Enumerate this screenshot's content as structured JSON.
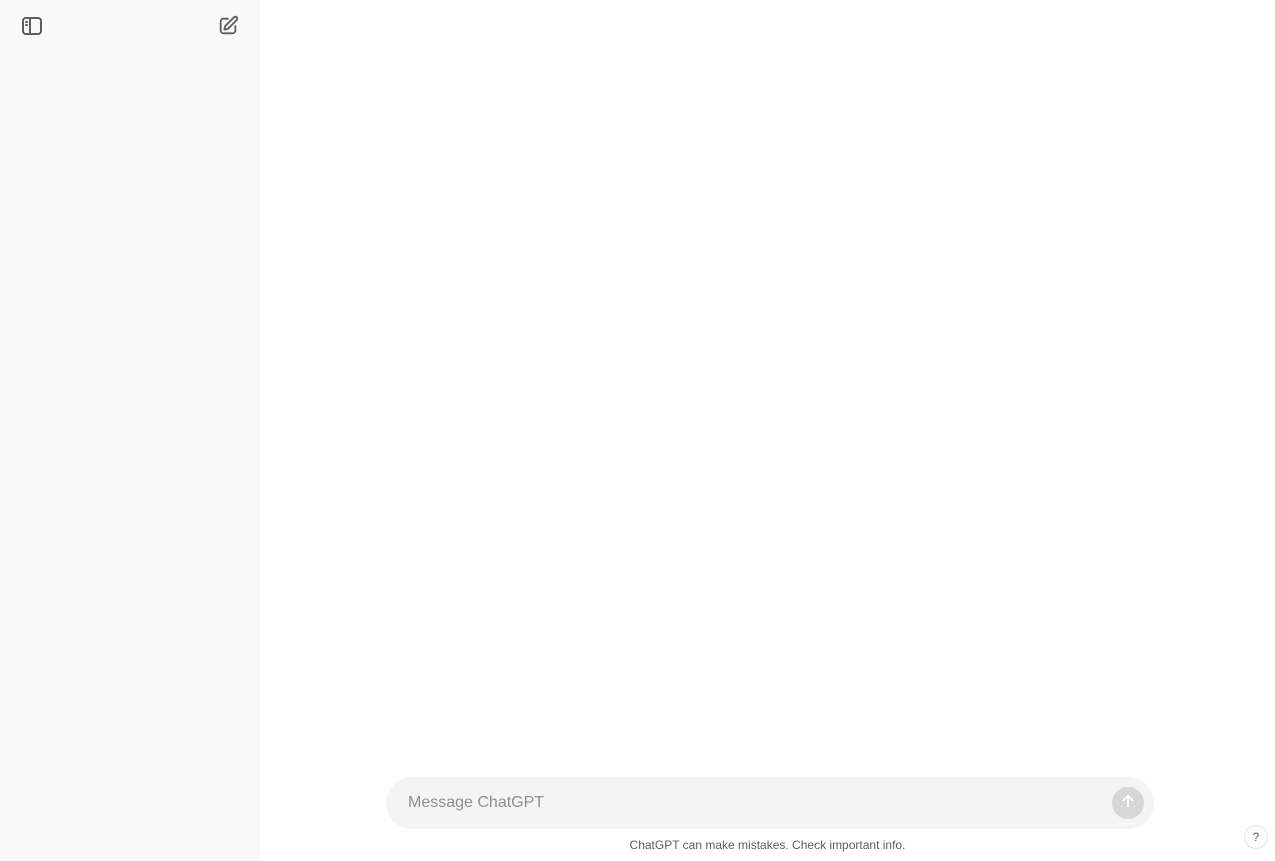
{
  "sidebar": {
    "toggle_icon": "sidebar-toggle-icon",
    "new_chat_icon": "new-chat-edit-icon"
  },
  "composer": {
    "placeholder": "Message ChatGPT",
    "value": "",
    "send_icon": "arrow-up-icon"
  },
  "footer": {
    "disclaimer": "ChatGPT can make mistakes. Check important info.",
    "help_label": "?"
  },
  "colors": {
    "sidebar_bg": "#f9f9f9",
    "composer_bg": "#f4f4f4",
    "send_disabled": "#d7d7d7",
    "icon": "#5d5d5d"
  }
}
